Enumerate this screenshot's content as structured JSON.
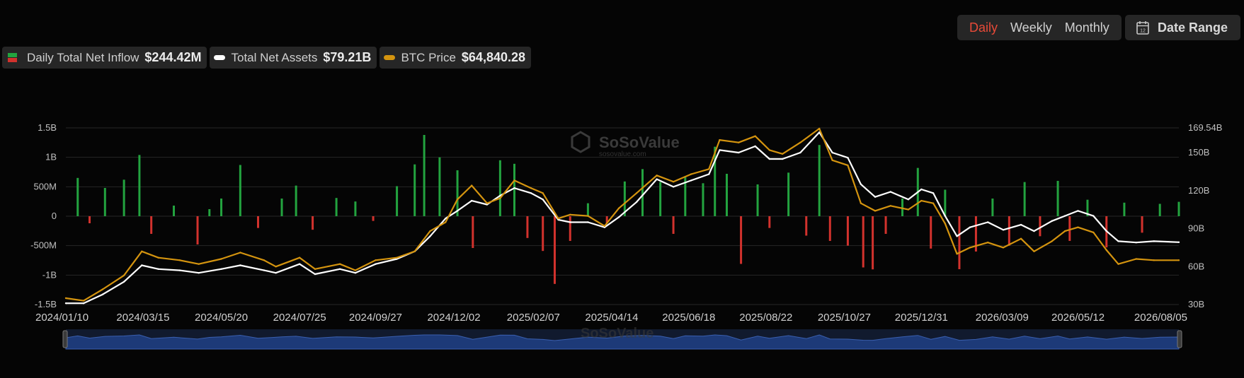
{
  "controls": {
    "periods": [
      "Daily",
      "Weekly",
      "Monthly"
    ],
    "active_period": "Daily",
    "date_range_label": "Date Range"
  },
  "legend": {
    "inflow": {
      "label": "Daily Total Net Inflow",
      "value": "$244.42M"
    },
    "assets": {
      "label": "Total Net Assets",
      "value": "$79.21B"
    },
    "btc": {
      "label": "BTC Price",
      "value": "$64,840.28"
    }
  },
  "watermark": {
    "brand": "SoSoValue",
    "site": "sosovalue.com"
  },
  "colors": {
    "background": "#050505",
    "inflow_positive": "#23a33f",
    "inflow_negative": "#d2322d",
    "net_assets": "#ffffff",
    "btc_price": "#d4940f",
    "active_period": "#e84a38",
    "navigator_fill": "#1d3a78"
  },
  "chart_data": {
    "type": "bar+line",
    "title": "",
    "x_start": "2024/01/10",
    "x_end": "2026/08/05",
    "x_tick_labels": [
      "2024/01/10",
      "2024/03/15",
      "2024/05/20",
      "2024/07/25",
      "2024/09/27",
      "2024/12/02",
      "2025/02/07",
      "2025/04/14",
      "2025/06/18",
      "2025/08/22",
      "2025/10/27",
      "2025/12/31",
      "2026/03/09",
      "2026/05/12",
      "2026/08/05"
    ],
    "y_left": {
      "ticks": [
        "1.5B",
        "1B",
        "500M",
        "0",
        "-500M",
        "-1B",
        "-1.5B"
      ],
      "range": [
        -1500,
        1500
      ],
      "unit": "M"
    },
    "y_right": {
      "ticks": [
        "169.54B",
        "150B",
        "120B",
        "90B",
        "60B",
        "30B"
      ],
      "tick_values": [
        169.54,
        150,
        120,
        90,
        60,
        30
      ],
      "range": [
        30,
        169.54
      ],
      "unit": "B"
    },
    "grid": true,
    "series": [
      {
        "name": "Daily Total Net Inflow",
        "type": "bar",
        "axis": "left",
        "unit": "M USD",
        "points": [
          [
            "2024/01/20",
            650
          ],
          [
            "2024/01/30",
            -120
          ],
          [
            "2024/02/12",
            480
          ],
          [
            "2024/02/28",
            620
          ],
          [
            "2024/03/12",
            1040
          ],
          [
            "2024/03/22",
            -300
          ],
          [
            "2024/04/10",
            180
          ],
          [
            "2024/04/30",
            -480
          ],
          [
            "2024/05/10",
            120
          ],
          [
            "2024/05/20",
            300
          ],
          [
            "2024/06/05",
            870
          ],
          [
            "2024/06/20",
            -200
          ],
          [
            "2024/07/10",
            300
          ],
          [
            "2024/07/22",
            520
          ],
          [
            "2024/08/05",
            -230
          ],
          [
            "2024/08/25",
            310
          ],
          [
            "2024/09/10",
            250
          ],
          [
            "2024/09/25",
            -80
          ],
          [
            "2024/10/15",
            510
          ],
          [
            "2024/10/30",
            880
          ],
          [
            "2024/11/07",
            1380
          ],
          [
            "2024/11/20",
            1000
          ],
          [
            "2024/12/05",
            780
          ],
          [
            "2024/12/18",
            -540
          ],
          [
            "2025/01/10",
            950
          ],
          [
            "2025/01/22",
            890
          ],
          [
            "2025/02/02",
            -370
          ],
          [
            "2025/02/15",
            -590
          ],
          [
            "2025/02/25",
            -1150
          ],
          [
            "2025/03/10",
            -420
          ],
          [
            "2025/03/25",
            220
          ],
          [
            "2025/04/10",
            -120
          ],
          [
            "2025/04/25",
            590
          ],
          [
            "2025/05/10",
            800
          ],
          [
            "2025/05/25",
            580
          ],
          [
            "2025/06/05",
            -300
          ],
          [
            "2025/06/15",
            680
          ],
          [
            "2025/06/30",
            560
          ],
          [
            "2025/07/10",
            1180
          ],
          [
            "2025/07/20",
            720
          ],
          [
            "2025/08/01",
            -810
          ],
          [
            "2025/08/15",
            540
          ],
          [
            "2025/08/25",
            -200
          ],
          [
            "2025/09/10",
            740
          ],
          [
            "2025/09/25",
            -330
          ],
          [
            "2025/10/06",
            1210
          ],
          [
            "2025/10/15",
            -420
          ],
          [
            "2025/10/30",
            -500
          ],
          [
            "2025/11/12",
            -870
          ],
          [
            "2025/11/20",
            -903
          ],
          [
            "2025/12/01",
            -300
          ],
          [
            "2025/12/15",
            300
          ],
          [
            "2025/12/28",
            820
          ],
          [
            "2026/01/08",
            -550
          ],
          [
            "2026/01/20",
            450
          ],
          [
            "2026/02/01",
            -900
          ],
          [
            "2026/02/15",
            -600
          ],
          [
            "2026/03/01",
            300
          ],
          [
            "2026/03/15",
            -500
          ],
          [
            "2026/03/28",
            580
          ],
          [
            "2026/04/10",
            -340
          ],
          [
            "2026/04/25",
            600
          ],
          [
            "2026/05/05",
            -420
          ],
          [
            "2026/05/20",
            280
          ],
          [
            "2026/06/05",
            -530
          ],
          [
            "2026/06/20",
            230
          ],
          [
            "2026/07/05",
            -280
          ],
          [
            "2026/07/20",
            210
          ],
          [
            "2026/08/05",
            244.42
          ]
        ]
      },
      {
        "name": "Total Net Assets",
        "type": "line",
        "axis": "right",
        "unit": "B USD",
        "points": [
          [
            "2024/01/10",
            31
          ],
          [
            "2024/01/25",
            31
          ],
          [
            "2024/02/10",
            38
          ],
          [
            "2024/02/28",
            48
          ],
          [
            "2024/03/14",
            61
          ],
          [
            "2024/03/28",
            58
          ],
          [
            "2024/04/15",
            57
          ],
          [
            "2024/05/01",
            55
          ],
          [
            "2024/05/20",
            58
          ],
          [
            "2024/06/05",
            61
          ],
          [
            "2024/06/25",
            57
          ],
          [
            "2024/07/05",
            55
          ],
          [
            "2024/07/25",
            62
          ],
          [
            "2024/08/07",
            54
          ],
          [
            "2024/08/28",
            58
          ],
          [
            "2024/09/10",
            55
          ],
          [
            "2024/09/27",
            62
          ],
          [
            "2024/10/15",
            66
          ],
          [
            "2024/10/30",
            72
          ],
          [
            "2024/11/12",
            84
          ],
          [
            "2024/11/25",
            98
          ],
          [
            "2024/12/05",
            104
          ],
          [
            "2024/12/17",
            112
          ],
          [
            "2024/12/30",
            109
          ],
          [
            "2025/01/10",
            116
          ],
          [
            "2025/01/22",
            122
          ],
          [
            "2025/02/05",
            118
          ],
          [
            "2025/02/15",
            113
          ],
          [
            "2025/02/28",
            97
          ],
          [
            "2025/03/10",
            95
          ],
          [
            "2025/03/25",
            95
          ],
          [
            "2025/04/08",
            91
          ],
          [
            "2025/04/20",
            99
          ],
          [
            "2025/05/05",
            111
          ],
          [
            "2025/05/22",
            129
          ],
          [
            "2025/06/05",
            123
          ],
          [
            "2025/06/20",
            128
          ],
          [
            "2025/07/05",
            133
          ],
          [
            "2025/07/14",
            152
          ],
          [
            "2025/07/30",
            150
          ],
          [
            "2025/08/13",
            155
          ],
          [
            "2025/08/25",
            145
          ],
          [
            "2025/09/05",
            145
          ],
          [
            "2025/09/20",
            150
          ],
          [
            "2025/10/06",
            166
          ],
          [
            "2025/10/17",
            150
          ],
          [
            "2025/10/30",
            146
          ],
          [
            "2025/11/10",
            125
          ],
          [
            "2025/11/22",
            115
          ],
          [
            "2025/12/05",
            119
          ],
          [
            "2025/12/20",
            113
          ],
          [
            "2025/12/31",
            121
          ],
          [
            "2026/01/10",
            118
          ],
          [
            "2026/01/20",
            100
          ],
          [
            "2026/01/30",
            84
          ],
          [
            "2026/02/10",
            91
          ],
          [
            "2026/02/25",
            95
          ],
          [
            "2026/03/10",
            89
          ],
          [
            "2026/03/25",
            93
          ],
          [
            "2026/04/05",
            88
          ],
          [
            "2026/04/20",
            96
          ],
          [
            "2026/05/01",
            100
          ],
          [
            "2026/05/12",
            104
          ],
          [
            "2026/05/25",
            100
          ],
          [
            "2026/06/05",
            88
          ],
          [
            "2026/06/15",
            80
          ],
          [
            "2026/06/30",
            79
          ],
          [
            "2026/07/15",
            80
          ],
          [
            "2026/08/05",
            79.21
          ]
        ]
      },
      {
        "name": "BTC Price",
        "type": "line",
        "axis": "right",
        "points": [
          [
            "2024/01/10",
            35
          ],
          [
            "2024/01/25",
            33
          ],
          [
            "2024/02/10",
            42
          ],
          [
            "2024/02/28",
            53
          ],
          [
            "2024/03/14",
            72
          ],
          [
            "2024/03/28",
            67
          ],
          [
            "2024/04/15",
            65
          ],
          [
            "2024/05/01",
            62
          ],
          [
            "2024/05/20",
            66
          ],
          [
            "2024/06/05",
            71
          ],
          [
            "2024/06/25",
            65
          ],
          [
            "2024/07/05",
            60
          ],
          [
            "2024/07/25",
            67
          ],
          [
            "2024/08/07",
            58
          ],
          [
            "2024/08/28",
            62
          ],
          [
            "2024/09/10",
            57
          ],
          [
            "2024/09/27",
            65
          ],
          [
            "2024/10/15",
            67
          ],
          [
            "2024/10/30",
            72
          ],
          [
            "2024/11/12",
            88
          ],
          [
            "2024/11/25",
            95
          ],
          [
            "2024/12/05",
            113
          ],
          [
            "2024/12/17",
            124
          ],
          [
            "2024/12/30",
            110
          ],
          [
            "2025/01/10",
            114
          ],
          [
            "2025/01/22",
            128
          ],
          [
            "2025/02/05",
            122
          ],
          [
            "2025/02/15",
            118
          ],
          [
            "2025/02/28",
            98
          ],
          [
            "2025/03/10",
            101
          ],
          [
            "2025/03/25",
            100
          ],
          [
            "2025/04/08",
            92
          ],
          [
            "2025/04/20",
            106
          ],
          [
            "2025/05/05",
            118
          ],
          [
            "2025/05/22",
            132
          ],
          [
            "2025/06/05",
            127
          ],
          [
            "2025/06/20",
            133
          ],
          [
            "2025/07/05",
            137
          ],
          [
            "2025/07/14",
            160
          ],
          [
            "2025/07/30",
            158
          ],
          [
            "2025/08/13",
            163
          ],
          [
            "2025/08/25",
            152
          ],
          [
            "2025/09/05",
            149
          ],
          [
            "2025/09/20",
            158
          ],
          [
            "2025/10/06",
            169
          ],
          [
            "2025/10/17",
            144
          ],
          [
            "2025/10/30",
            140
          ],
          [
            "2025/11/10",
            110
          ],
          [
            "2025/11/22",
            104
          ],
          [
            "2025/12/05",
            108
          ],
          [
            "2025/12/20",
            105
          ],
          [
            "2025/12/31",
            112
          ],
          [
            "2026/01/10",
            110
          ],
          [
            "2026/01/20",
            94
          ],
          [
            "2026/01/30",
            70
          ],
          [
            "2026/02/10",
            75
          ],
          [
            "2026/02/25",
            79
          ],
          [
            "2026/03/10",
            75
          ],
          [
            "2026/03/25",
            82
          ],
          [
            "2026/04/05",
            72
          ],
          [
            "2026/04/20",
            80
          ],
          [
            "2026/05/01",
            88
          ],
          [
            "2026/05/12",
            91
          ],
          [
            "2026/05/25",
            87
          ],
          [
            "2026/06/05",
            73
          ],
          [
            "2026/06/15",
            62
          ],
          [
            "2026/06/30",
            66
          ],
          [
            "2026/07/15",
            65
          ],
          [
            "2026/08/05",
            65
          ]
        ]
      }
    ]
  }
}
